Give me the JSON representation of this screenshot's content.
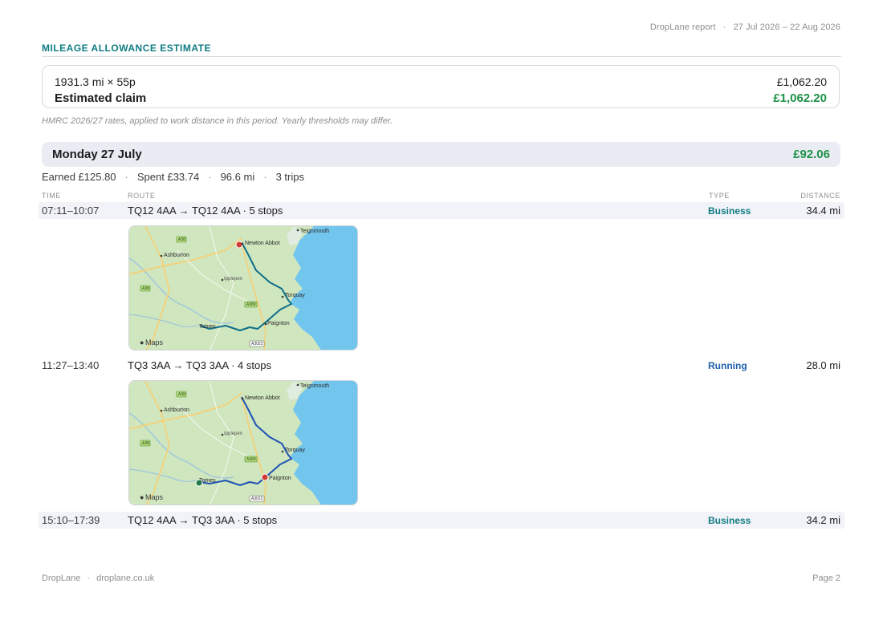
{
  "header": {
    "brand": "DropLane report",
    "separator": "·",
    "date_range": "27 Jul 2026 – 22 Aug 2026"
  },
  "section": {
    "title": "MILEAGE ALLOWANCE ESTIMATE"
  },
  "summary": {
    "calc_label": "1931.3 mi × 55p",
    "calc_value": "£1,062.20",
    "claim_label": "Estimated claim",
    "claim_value": "£1,062.20"
  },
  "note": "HMRC 2026/27 rates, applied to work distance in this period. Yearly thresholds may differ.",
  "day": {
    "title": "Monday 27 July",
    "total": "£92.06",
    "stats": [
      "Earned £125.80",
      "Spent £33.74",
      "96.6 mi",
      "3 trips"
    ],
    "stat_separator": "·"
  },
  "columns": {
    "time": "TIME",
    "route": "ROUTE",
    "type": "TYPE",
    "distance": "DISTANCE"
  },
  "trips": [
    {
      "time": "07:11–10:07",
      "route": "TQ12 4AA → TQ12 4AA  ·  5 stops",
      "type": "Business",
      "distance": "34.4 mi"
    },
    {
      "time": "11:27–13:40",
      "route": "TQ3 3AA → TQ3 3AA  ·  4 stops",
      "type": "Running",
      "distance": "28.0 mi"
    },
    {
      "time": "15:10–17:39",
      "route": "TQ12 4AA → TQ3 3AA  ·  5 stops",
      "type": "Business",
      "distance": "34.2 mi"
    }
  ],
  "map": {
    "places": [
      "Teignmouth",
      "Newton Abbot",
      "Ashburton",
      "Ipplepen",
      "Torquay",
      "Paignton",
      "Totnes"
    ],
    "roads": [
      "A38",
      "A380",
      "A3022"
    ],
    "attribution": "Maps",
    "colors": {
      "land": "#cfe6bf",
      "sea": "#72c6ee",
      "route": "#0f6f8a",
      "route_running": "#1f52b3",
      "start_marker": "#1f7a4a",
      "end_marker": "#d03b34"
    }
  },
  "footer": {
    "brand": "DropLane",
    "separator": "·",
    "site": "droplane.co.uk",
    "page": "Page 2"
  }
}
